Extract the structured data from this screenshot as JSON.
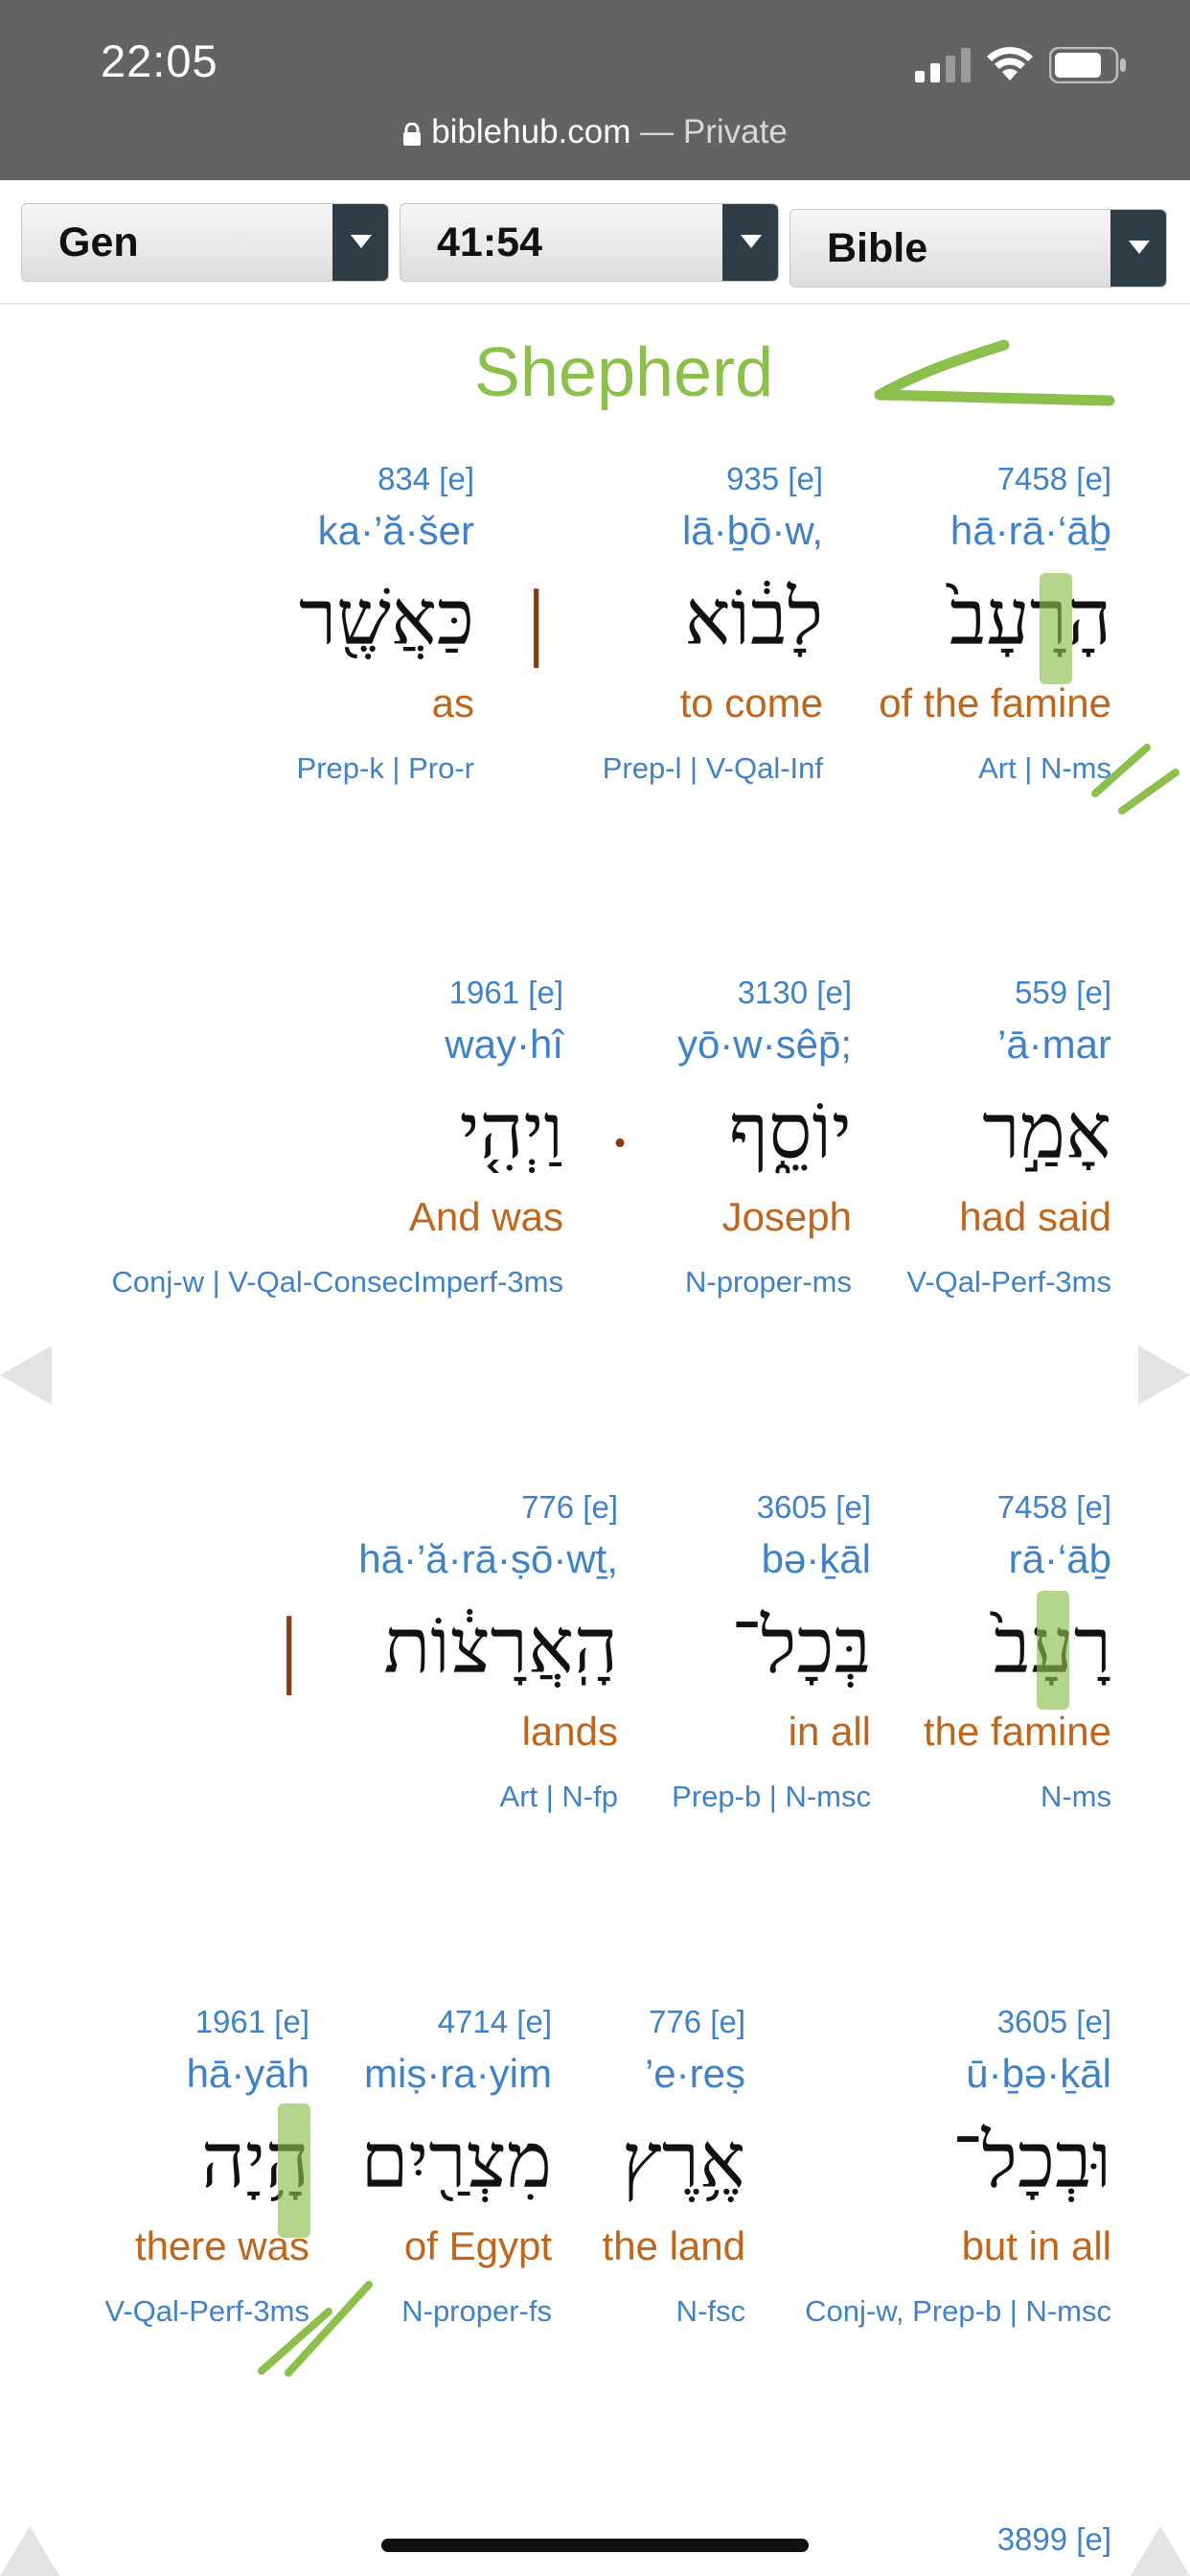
{
  "status_bar": {
    "time": "22:05"
  },
  "browser": {
    "url": "biblehub.com",
    "mode": "— Private"
  },
  "nav": {
    "book": "Gen",
    "chapter_verse": "41:54",
    "version": "Bible"
  },
  "heading": "Shepherd",
  "rows": [
    {
      "words": [
        {
          "num": "7458",
          "e": "[e]",
          "translit": "hā·rā·‘āḇ",
          "hebrew": "הָרָעָב֙",
          "english": "of the famine",
          "parse": "Art | N-ms"
        },
        {
          "num": "935",
          "e": "[e]",
          "translit": "lā·ḇō·w,",
          "hebrew": "לָב֔וֹא",
          "english": "to come",
          "parse": "Prep-l | V-Qal-Inf"
        },
        {
          "num": "834",
          "e": "[e]",
          "translit": "ka·’ă·šer",
          "hebrew": "כַּאֲשֶׁ֖ר",
          "english": "as",
          "parse": "Prep-k | Pro-r"
        }
      ],
      "punct": "׀"
    },
    {
      "words": [
        {
          "num": "559",
          "e": "[e]",
          "translit": "’ā·mar",
          "hebrew": "אָמַ֣ר",
          "english": "had said",
          "parse": "V-Qal-Perf-3ms"
        },
        {
          "num": "3130",
          "e": "[e]",
          "translit": "yō·w·sêp̄;",
          "hebrew": "יוֹסֵ֑ף",
          "english": "Joseph",
          "parse": "N-proper-ms"
        },
        {
          "num": "1961",
          "e": "[e]",
          "translit": "way·hî",
          "hebrew": "וַיְהִ֤י",
          "english": "And was",
          "parse": "Conj-w | V-Qal-ConsecImperf-3ms"
        }
      ],
      "punct": "·"
    },
    {
      "words": [
        {
          "num": "7458",
          "e": "[e]",
          "translit": "rā·‘āḇ",
          "hebrew": "רָעָב֙",
          "english": "the famine",
          "parse": "N-ms"
        },
        {
          "num": "3605",
          "e": "[e]",
          "translit": "bə·ḵāl",
          "hebrew": "בְּכָל־",
          "english": "in all",
          "parse": "Prep-b | N-msc"
        },
        {
          "num": "776",
          "e": "[e]",
          "translit": "hā·’ă·rā·ṣō·wṯ,",
          "hebrew": "הָֽאֲרָצ֔וֹת",
          "english": "lands",
          "parse": "Art | N-fp"
        }
      ],
      "punct": "׀"
    },
    {
      "words": [
        {
          "num": "3605",
          "e": "[e]",
          "translit": "ū·ḇə·ḵāl",
          "hebrew": "וּבְכָל־",
          "english": "but in all",
          "parse": "Conj-w, Prep-b | N-msc"
        },
        {
          "num": "776",
          "e": "[e]",
          "translit": "’e·reṣ",
          "hebrew": "אֶ֥רֶץ",
          "english": "the land",
          "parse": "N-fsc"
        },
        {
          "num": "4714",
          "e": "[e]",
          "translit": "miṣ·ra·yim",
          "hebrew": "מִצְרַ֖יִם",
          "english": "of Egypt",
          "parse": "N-proper-fs"
        },
        {
          "num": "1961",
          "e": "[e]",
          "translit": "hā·yāh",
          "hebrew": "הָ֥יָה",
          "english": "there was",
          "parse": "V-Qal-Perf-3ms"
        }
      ]
    },
    {
      "words": [
        {
          "num": "3899",
          "e": "[e]"
        }
      ]
    }
  ],
  "colors": {
    "strongs_blue": "#3f82c7",
    "english_orange": "#c1651b",
    "highlight_green": "#8dbf4d",
    "status_gray": "#636363"
  }
}
